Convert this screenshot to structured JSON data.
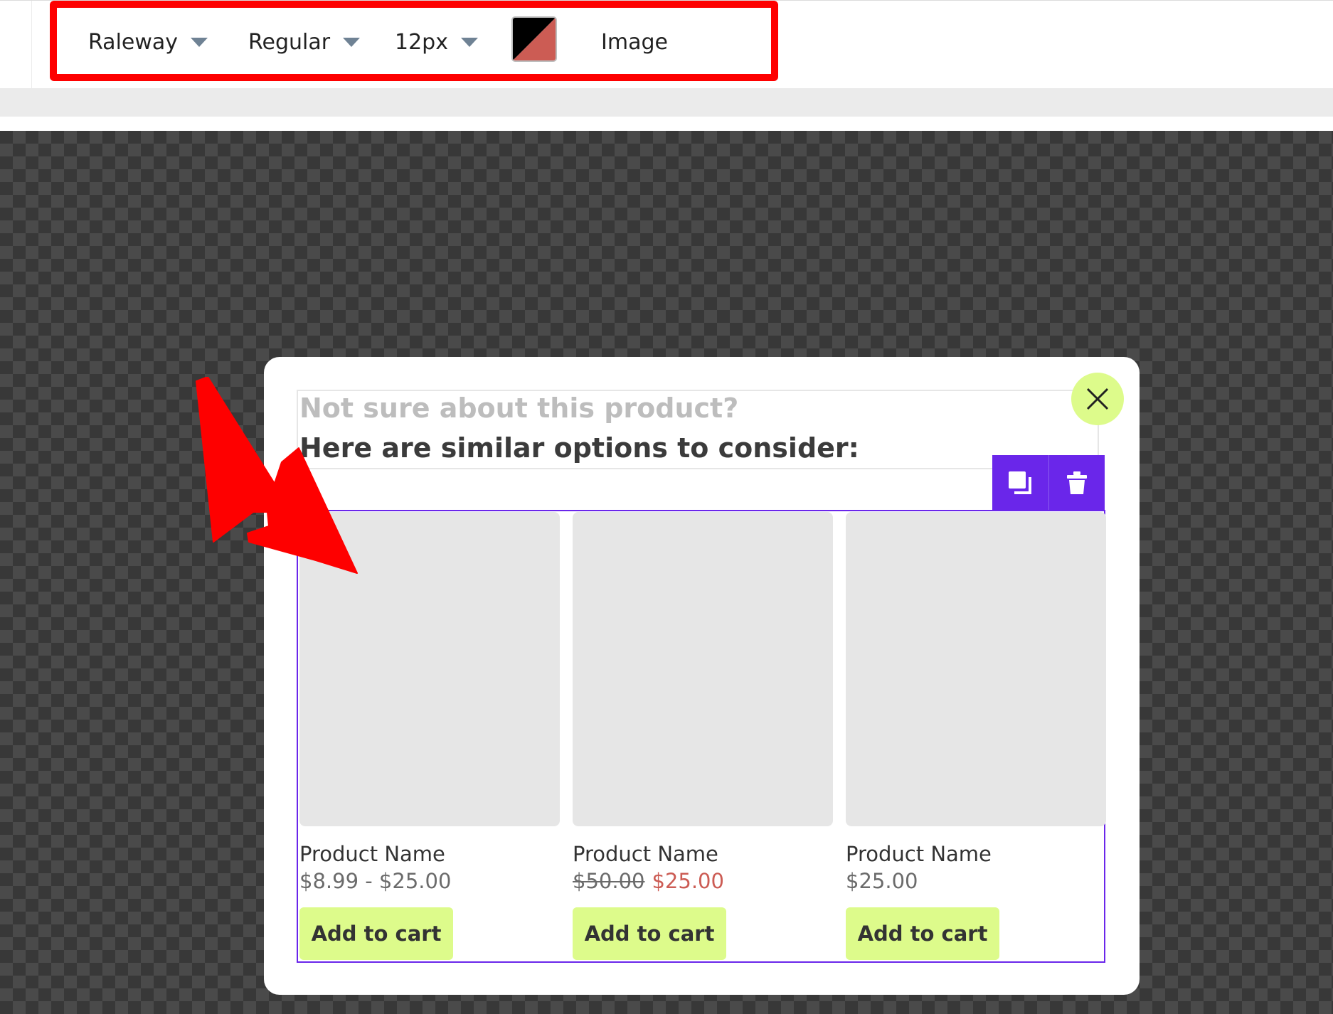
{
  "toolbar": {
    "font_family": "Raleway",
    "font_weight": "Regular",
    "font_size": "12px",
    "color_swatch": [
      "#000000",
      "#cc5c54"
    ],
    "image_label": "Image"
  },
  "popup": {
    "heading_line1": "Not sure about this product?",
    "heading_line2": "Here are similar options to consider:",
    "products": [
      {
        "name": "Product Name",
        "price": "$8.99 - $25.00",
        "button": "Add to cart"
      },
      {
        "name": "Product Name",
        "price_old": "$50.00",
        "price_sale": "$25.00",
        "button": "Add to cart"
      },
      {
        "name": "Product Name",
        "price": "$25.00",
        "button": "Add to cart"
      }
    ]
  },
  "colors": {
    "highlight": "#fe0000",
    "accent_purple": "#6a26ea",
    "button_green": "#ddfb8b",
    "sale_red": "#cc5c54"
  }
}
